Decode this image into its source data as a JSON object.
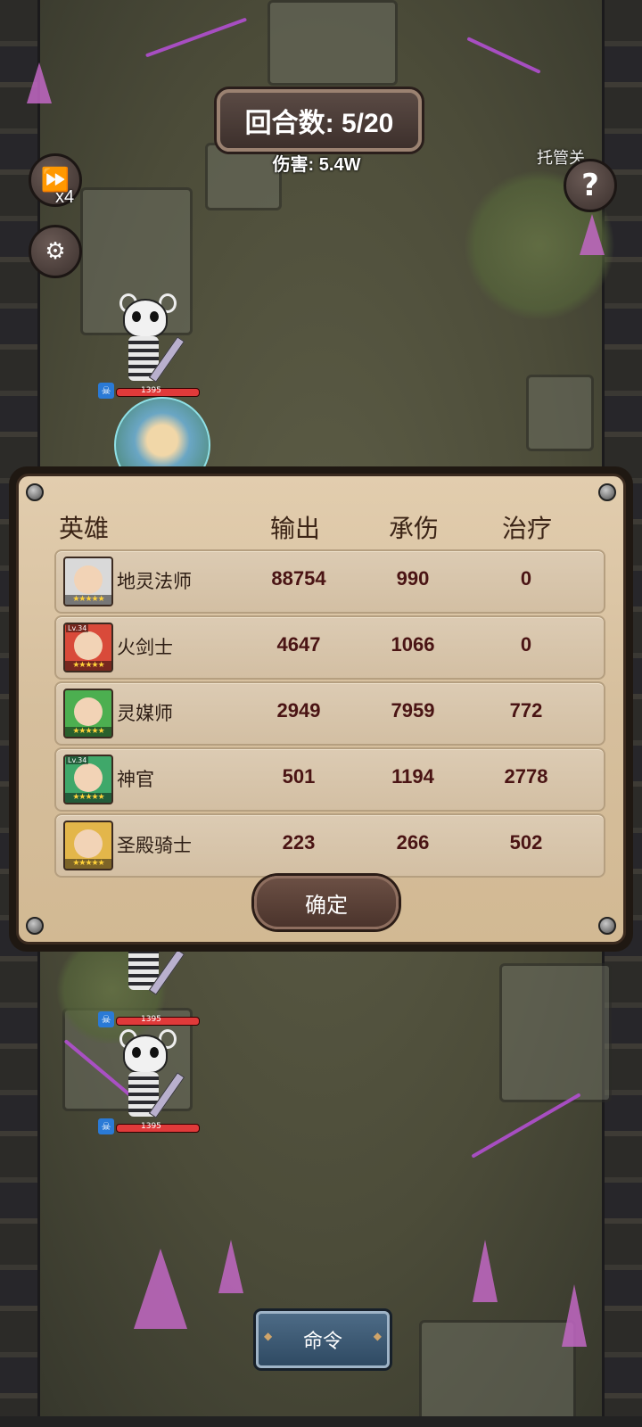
{
  "hud": {
    "round": "回合数: 5/20",
    "damage": "伤害: 5.4W",
    "speed": "x4",
    "auto": "托管关",
    "help": "?"
  },
  "units": [
    {
      "hp": "1395"
    },
    {
      "hp": "1395"
    },
    {
      "hp": "1395"
    }
  ],
  "stats_panel": {
    "headers": {
      "hero": "英雄",
      "output": "输出",
      "tank": "承伤",
      "heal": "治疗"
    },
    "rows": [
      {
        "name": "地灵法师",
        "output": "88754",
        "tank": "990",
        "heal": "0",
        "color": "#d9d9d9",
        "stars": "★★★★★"
      },
      {
        "name": "火剑士",
        "output": "4647",
        "tank": "1066",
        "heal": "0",
        "color": "#d94a3a",
        "level": "Lv.34",
        "stars": "★★★★★"
      },
      {
        "name": "灵媒师",
        "output": "2949",
        "tank": "7959",
        "heal": "772",
        "color": "#4caf50",
        "stars": "★★★★★"
      },
      {
        "name": "神官",
        "output": "501",
        "tank": "1194",
        "heal": "2778",
        "color": "#3fa86a",
        "level": "Lv.34",
        "stars": "★★★★★"
      },
      {
        "name": "圣殿骑士",
        "output": "223",
        "tank": "266",
        "heal": "502",
        "color": "#e3b64a",
        "stars": "★★★★★"
      }
    ],
    "confirm_label": "确定"
  },
  "command_label": "命令"
}
